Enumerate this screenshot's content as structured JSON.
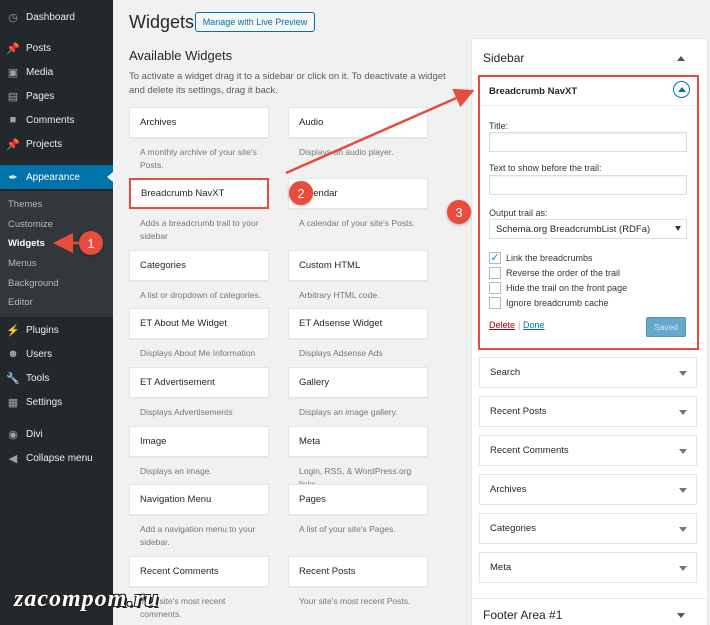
{
  "admin_menu": {
    "items": [
      {
        "label": "Dashboard",
        "icon": "dashboard-icon"
      },
      {
        "label": "Posts",
        "icon": "pushpin-icon"
      },
      {
        "label": "Media",
        "icon": "media-icon"
      },
      {
        "label": "Pages",
        "icon": "pages-icon"
      },
      {
        "label": "Comments",
        "icon": "comment-icon"
      },
      {
        "label": "Projects",
        "icon": "pushpin-icon"
      },
      {
        "label": "Appearance",
        "icon": "brush-icon"
      },
      {
        "label": "Plugins",
        "icon": "plugin-icon"
      },
      {
        "label": "Users",
        "icon": "users-icon"
      },
      {
        "label": "Tools",
        "icon": "wrench-icon"
      },
      {
        "label": "Settings",
        "icon": "settings-icon"
      },
      {
        "label": "Divi",
        "icon": "divi-icon"
      },
      {
        "label": "Collapse menu",
        "icon": "collapse-icon"
      }
    ],
    "submenu": [
      "Themes",
      "Customize",
      "Widgets",
      "Menus",
      "Background",
      "Editor"
    ]
  },
  "header": {
    "title": "Widgets",
    "live_preview_label": "Manage with Live Preview"
  },
  "available": {
    "title": "Available Widgets",
    "description": "To activate a widget drag it to a sidebar or click on it. To deactivate a widget and delete its settings, drag it back."
  },
  "widgets": [
    {
      "name": "Archives",
      "desc": "A monthly archive of your site's Posts."
    },
    {
      "name": "Audio",
      "desc": "Displays an audio player."
    },
    {
      "name": "Breadcrumb NavXT",
      "desc": "Adds a breadcrumb trail to your sidebar"
    },
    {
      "name": "Calendar",
      "desc": "A calendar of your site's Posts."
    },
    {
      "name": "Categories",
      "desc": "A list or dropdown of categories."
    },
    {
      "name": "Custom HTML",
      "desc": "Arbitrary HTML code."
    },
    {
      "name": "ET About Me Widget",
      "desc": "Displays About Me Information"
    },
    {
      "name": "ET Adsense Widget",
      "desc": "Displays Adsense Ads"
    },
    {
      "name": "ET Advertisement",
      "desc": "Displays Advertisements"
    },
    {
      "name": "Gallery",
      "desc": "Displays an image gallery."
    },
    {
      "name": "Image",
      "desc": "Displays an image."
    },
    {
      "name": "Meta",
      "desc": "Login, RSS, & WordPress.org links."
    },
    {
      "name": "Navigation Menu",
      "desc": "Add a navigation menu to your sidebar."
    },
    {
      "name": "Pages",
      "desc": "A list of your site's Pages."
    },
    {
      "name": "Recent Comments",
      "desc": "Your site's most recent comments."
    },
    {
      "name": "Recent Posts",
      "desc": "Your site's most recent Posts."
    }
  ],
  "sidebar": {
    "title": "Sidebar",
    "open_widget": {
      "title": "Breadcrumb NavXT",
      "title_label": "Title:",
      "title_value": "",
      "before_label": "Text to show before the trail:",
      "before_value": "",
      "output_label": "Output trail as:",
      "output_value": "Schema.org BreadcrumbList (RDFa)",
      "options": [
        {
          "label": "Link the breadcrumbs",
          "checked": true
        },
        {
          "label": "Reverse the order of the trail",
          "checked": false
        },
        {
          "label": "Hide the trail on the front page",
          "checked": false
        },
        {
          "label": "Ignore breadcrumb cache",
          "checked": false
        }
      ],
      "delete_label": "Delete",
      "separator": "|",
      "done_label": "Done",
      "saved_label": "Saved"
    },
    "widgets": [
      "Search",
      "Recent Posts",
      "Recent Comments",
      "Archives",
      "Categories",
      "Meta"
    ]
  },
  "footer_area": {
    "title": "Footer Area #1"
  },
  "annotations": [
    "1",
    "2",
    "3"
  ],
  "watermark": "zacompom.ru",
  "colors": {
    "admin_bg": "#23282d",
    "accent": "#0073aa",
    "highlight_red": "#e74c3c"
  }
}
